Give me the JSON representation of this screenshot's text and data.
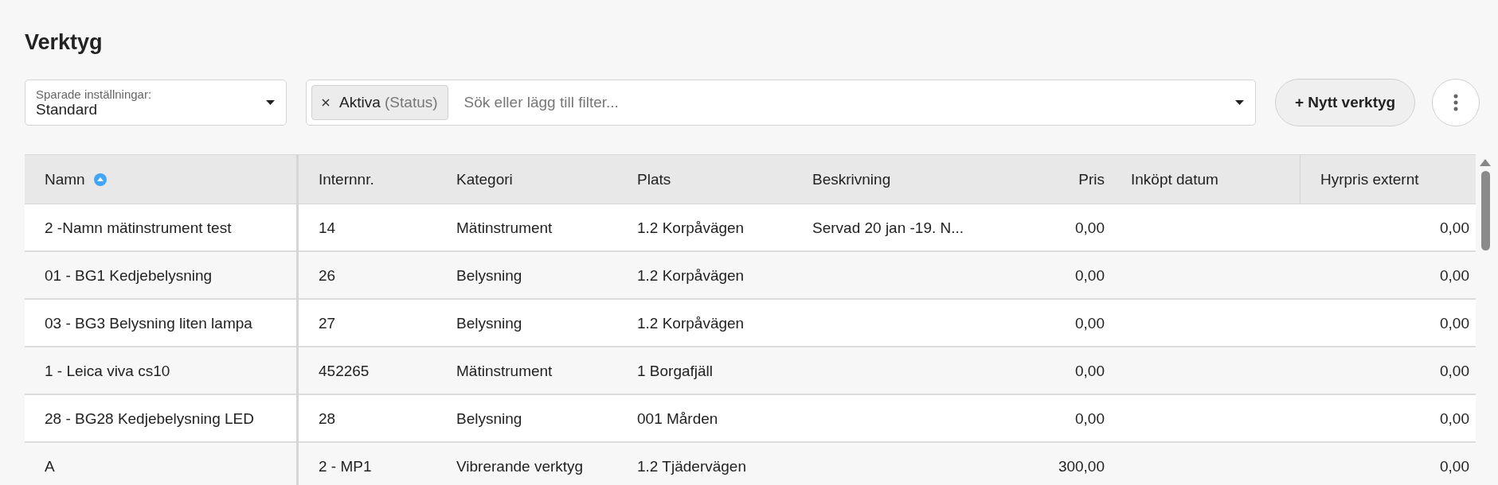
{
  "page": {
    "title": "Verktyg"
  },
  "saved_settings": {
    "label": "Sparade inställningar:",
    "value": "Standard"
  },
  "filter": {
    "chips": [
      {
        "label": "Aktiva",
        "qualifier": "(Status)"
      }
    ],
    "placeholder": "Sök eller lägg till filter..."
  },
  "new_button": {
    "label": "+ Nytt verktyg"
  },
  "table": {
    "columns": [
      {
        "label": "Namn",
        "kind": "text",
        "sorted": true
      },
      {
        "label": "Internnr.",
        "kind": "text",
        "sorted": false
      },
      {
        "label": "Kategori",
        "kind": "text",
        "sorted": false
      },
      {
        "label": "Plats",
        "kind": "text",
        "sorted": false
      },
      {
        "label": "Beskrivning",
        "kind": "text",
        "sorted": false
      },
      {
        "label": "Pris",
        "kind": "number",
        "sorted": false
      },
      {
        "label": "Inköpt datum",
        "kind": "text",
        "sorted": false
      },
      {
        "label": "Hyrpris externt",
        "kind": "number",
        "sorted": false
      }
    ],
    "rows": [
      {
        "cells": [
          "2 -Namn mätinstrument test",
          "14",
          "Mätinstrument",
          "1.2 Korpåvägen",
          "Servad 20 jan -19. N...",
          "0,00",
          null,
          "0,00"
        ]
      },
      {
        "cells": [
          "01 - BG1 Kedjebelysning",
          "26",
          "Belysning",
          "1.2 Korpåvägen",
          null,
          "0,00",
          null,
          "0,00"
        ]
      },
      {
        "cells": [
          "03 - BG3 Belysning liten lampa",
          "27",
          "Belysning",
          "1.2 Korpåvägen",
          null,
          "0,00",
          null,
          "0,00"
        ]
      },
      {
        "cells": [
          "1 - Leica viva cs10",
          "452265",
          "Mätinstrument",
          "1 Borgafjäll",
          null,
          "0,00",
          null,
          "0,00"
        ]
      },
      {
        "cells": [
          "28 - BG28 Kedjebelysning LED",
          "28",
          "Belysning",
          "001 Mården",
          null,
          "0,00",
          null,
          "0,00"
        ]
      },
      {
        "cells": [
          "A",
          "2 - MP1",
          "Vibrerande verktyg",
          "1.2 Tjädervägen",
          null,
          "300,00",
          null,
          "0,00"
        ]
      }
    ]
  }
}
